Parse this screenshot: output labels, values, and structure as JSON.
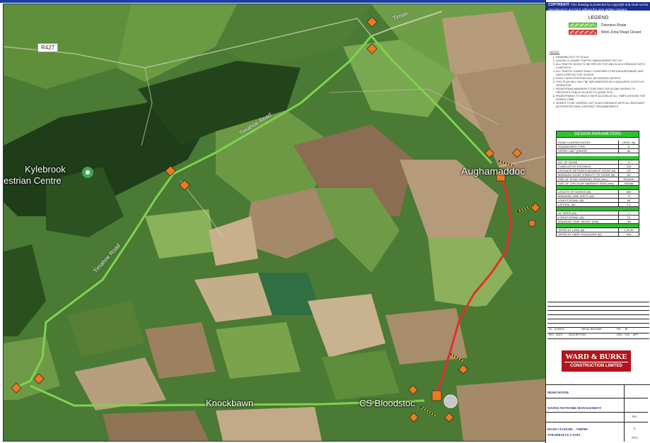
{
  "copyright": {
    "label": "COPYRIGHT:",
    "text": "This drawing is protected by copyright and must not be reproduced in any form without the prior written consent."
  },
  "legend": {
    "title": "LEGEND",
    "items": [
      {
        "label": "Diversion Route",
        "color": "#7fd34e"
      },
      {
        "label": "Work Zone/ Road Closed",
        "color": "#e0484a"
      }
    ]
  },
  "notes": {
    "title": "NOTES:",
    "items": [
      "DRAWING NOT TO SCALE",
      "A ROAD CLOSURE TRAFFIC MANAGEMENT SET-UP",
      "ALL TRAFFIC SIGNS TO BE REFLECTIVE AND IN ACCORDANCE WITH CHAPTER 8",
      "ALL TRAFFIC CONES SHALL CONFORM TO BE ENCASED/BASE AND HAVE A REFLECTIVE SLEEVE",
      "EXACT SIGN POSITION WILL BE AGREED ON SITE",
      "THIS PLAN MAY ONLY BE IMPLEMENTED BY A QUALIFIED CSCS SLG OPERATIVE",
      "PEDESTRIAN BARRIERS TO BE ERECTED ALONG WORKS TO PREVENTS PUBLIC ACCESS TO WORK SITE",
      "PEDESTRIANS TO HAVE A SAFE ACCESS AT ALL TIMES AROUND THE WORKS ZONE",
      "WORKS TO BE CARRIED OUT IN ACCORDANCE WITH ALL RELEVANT AUTHORITIES AND CONTRACT REQUIREMENTS"
    ]
  },
  "design_parameters": {
    "title": "DESIGN PARAMETERS",
    "general": [
      {
        "label": "ROAD CLASSIFICATION",
        "value": "LEVEL 2(i)"
      },
      {
        "label": "ROADWORKS TYPE",
        "value": "A"
      },
      {
        "label": "SPEED LIMIT (KM/HR)",
        "value": "80"
      }
    ],
    "group1": [
      {
        "label": "NO. OF SIGNS",
        "value": "3"
      },
      {
        "label": "CUMULATIVE DISTANCE",
        "value": "200"
      },
      {
        "label": "DISTANCE BETWEEN ADVANCE SIGNS (M)",
        "value": "120"
      },
      {
        "label": "MINIMUM CLEAR VISIBILITY OF SIGNS (M)",
        "value": "60"
      },
      {
        "label": "SIZE OF ROAD WARNING SIGN (mm)",
        "value": "900x900"
      },
      {
        "label": "SIZE OF CIRCULAR WARNING SIGN (mm)",
        "value": "600dia"
      }
    ],
    "group2": [
      {
        "label": "LENGTH OF WORKS (M)",
        "value": "800"
      },
      {
        "label": "MINIMUM LANE WIDTH (M)",
        "value": "3"
      },
      {
        "label": "LONGITUDINAL (M)",
        "value": "60"
      },
      {
        "label": "LATERAL (M)",
        "value": "1.2"
      }
    ],
    "group3": [
      {
        "label": "AT TAPER (M)",
        "value": "1"
      },
      {
        "label": "LONGITUDINAL (M)",
        "value": "12"
      },
      {
        "label": "MINIMUM CONE HEIGHT (MM)",
        "value": "750"
      }
    ],
    "group4": [
      {
        "label": "TAPER AT LANE (M)",
        "value": "1 IN 30"
      },
      {
        "label": "TAPER AT HARD SHOULDER (M)",
        "value": "N/A"
      }
    ]
  },
  "revision": {
    "rev": "00",
    "date": "01/09/22",
    "description": "INITIAL RELEASE",
    "drawn": "PM",
    "checked": "JB",
    "approved": "-",
    "headers": {
      "rev": "REV",
      "date": "DATE",
      "description": "DESCRIPTION",
      "drawn": "DRN",
      "checked": "CHK",
      "approved": "APP"
    }
  },
  "logo": {
    "main": "WARD & BURKE",
    "sub": "CONSTRUCTION LIMITED"
  },
  "title_block": {
    "client": "IRISH WATER",
    "project": "WATER NETWORK MANAGEMENT",
    "drawing_title_line1": "ROAD CLOSURE – TMP001",
    "drawing_title_line2": "STRADBALLY, LAOIS",
    "dwg_no": "001",
    "revision": "0",
    "scale": "NTS"
  },
  "map": {
    "labels": {
      "place1_line1": "Kylebrook",
      "place1_line2": "estrian Centre",
      "place2": "Aughamaddoc",
      "place3": "Knockbawn",
      "place4": "CS Bloodstoc",
      "road1": "Timahoe Road",
      "road2": "Timahoe Road",
      "road3": "Timah",
      "route": "R427"
    }
  }
}
